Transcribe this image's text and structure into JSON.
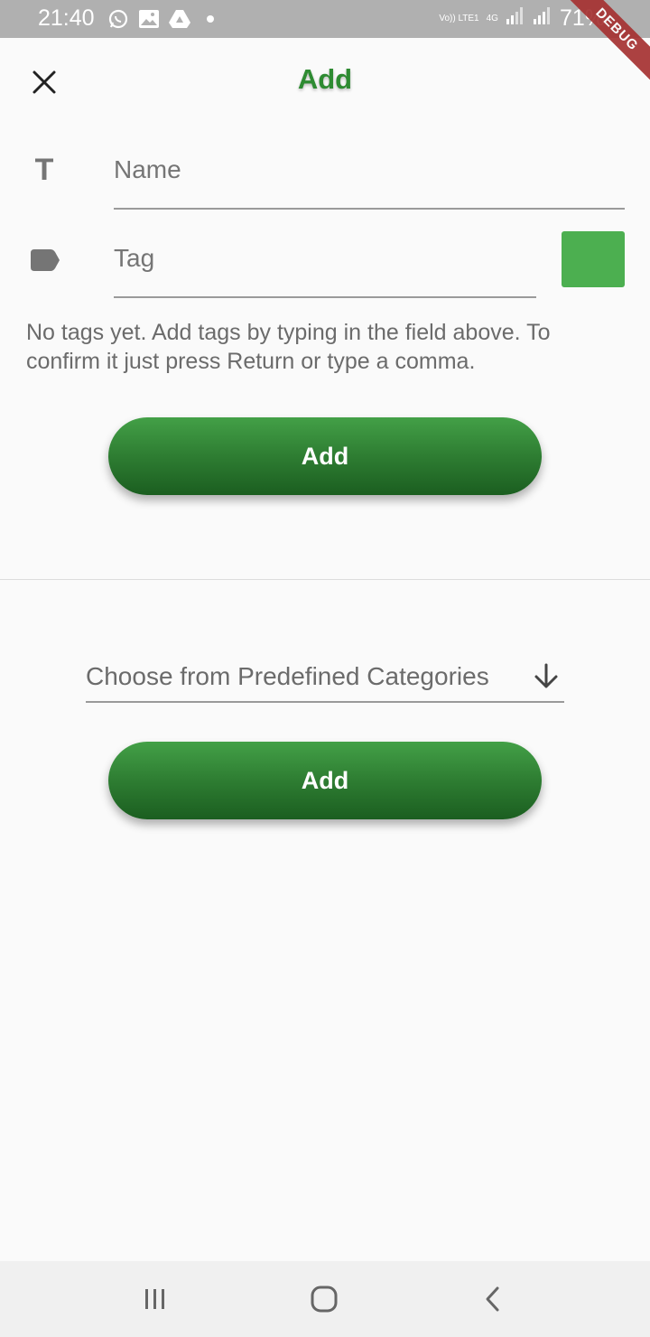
{
  "status_bar": {
    "time": "21:40",
    "signal_text": "Vo)) LTE1",
    "network_text": "4G",
    "battery_percent": "71%"
  },
  "debug_banner": "DEBUG",
  "app_bar": {
    "title": "Add",
    "title_color": "#2e8b32"
  },
  "form": {
    "name_placeholder": "Name",
    "name_value": "",
    "tag_placeholder": "Tag",
    "tag_value": "",
    "tag_color": "#4caf50",
    "helper_text": "No tags yet. Add tags by typing in the field above. To confirm it just press Return or type a comma.",
    "add_button_label": "Add"
  },
  "predefined": {
    "dropdown_label": "Choose from Predefined Categories",
    "add_button_label": "Add"
  },
  "icons": {
    "close": "close-icon",
    "name_field": "text-format-icon",
    "tag_field": "label-icon",
    "dropdown": "arrow-down-icon"
  },
  "colors": {
    "accent": "#2e7d32",
    "status_bar": "#b0b0b0",
    "debug_ribbon": "#a63232"
  }
}
